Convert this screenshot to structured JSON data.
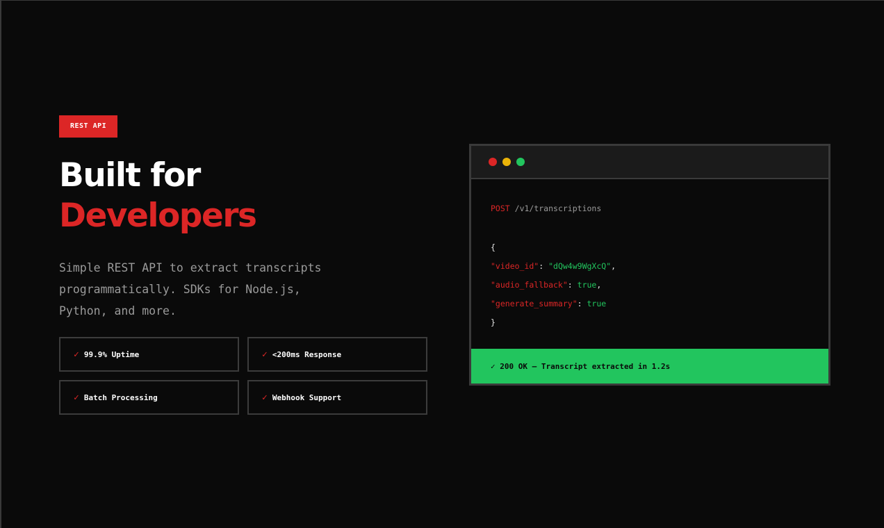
{
  "hero": {
    "badge": "REST API",
    "headline_line1": "Built for",
    "headline_line2": "Developers",
    "description": "Simple REST API to extract transcripts programmatically. SDKs for Node.js, Python, and more.",
    "features": [
      {
        "check": "✓",
        "label": "99.9% Uptime"
      },
      {
        "check": "✓",
        "label": "<200ms Response"
      },
      {
        "check": "✓",
        "label": "Batch Processing"
      },
      {
        "check": "✓",
        "label": "Webhook Support"
      }
    ]
  },
  "terminal": {
    "dots": [
      "#dc2626",
      "#eab308",
      "#22c55e"
    ],
    "method": "POST",
    "path": "/v1/transcriptions",
    "open_brace": "{",
    "close_brace": "}",
    "fields": [
      {
        "key": "\"video_id\"",
        "sep": ": ",
        "value": "\"dQw4w9WgXcQ\"",
        "trail": ","
      },
      {
        "key": "\"audio_fallback\"",
        "sep": ": ",
        "value": "true",
        "trail": ","
      },
      {
        "key": "\"generate_summary\"",
        "sep": ": ",
        "value": "true",
        "trail": ""
      }
    ],
    "status": "✓ 200 OK — Transcript extracted in 1.2s"
  },
  "colors": {
    "accent": "#dc2626",
    "success": "#22c55e",
    "background": "#0a0a0a"
  }
}
